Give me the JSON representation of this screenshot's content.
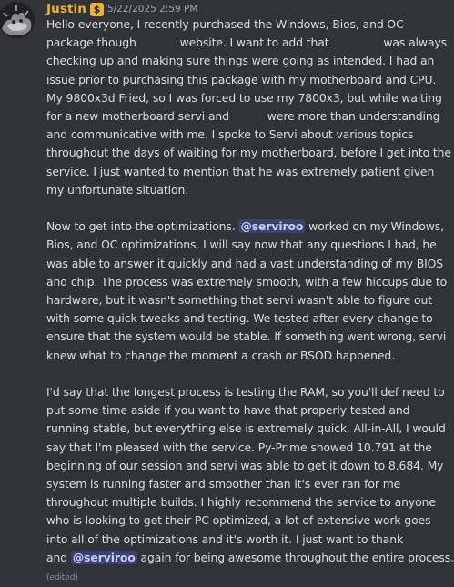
{
  "author": {
    "name": "Justin",
    "badge_icon": "dollar-badge-icon",
    "badge_symbol": "$",
    "badge_color": "#f0b232",
    "avatar_icon": "avatar-icon"
  },
  "timestamp": "5/22/2025 2:59 PM",
  "message": {
    "p1": {
      "s1": "Hello everyone, I recently purchased the Windows, Bios, and OC package though",
      "s2": "website. I want to add that",
      "s3": "was always checking up and making sure things were going as intended. I had an issue prior to purchasing this package with my motherboard and CPU. My 9800x3d Fried, so I was forced to use my 7800x3, but while waiting for a new motherboard servi and",
      "s4": "were more than understanding and communicative with me. I spoke to Servi about various topics throughout the days of waiting for my motherboard, before I get into the service. I just wanted to mention that he was extremely patient given my unfortunate situation."
    },
    "p2": {
      "s1": "Now to get into the optimizations.",
      "mention": "@serviroo",
      "s2": "worked on my Windows, Bios, and OC optimizations. I will say now that any questions I had, he was able to answer it quickly and had a vast understanding of my BIOS and chip. The process was extremely smooth, with a few hiccups due to hardware, but it wasn't something that servi wasn't able to figure out with some quick tweaks and testing. We tested after every change to ensure that the system would be stable. If something went wrong, servi knew what to change the moment a crash or BSOD happened."
    },
    "p3": {
      "s1": "I'd say that the longest process is testing the RAM, so you'll def need to put some time aside if you want to have that properly tested and running stable, but everything else is extremely quick. All-in-All, I would say that I'm pleased with the service. Py-Prime showed 10.791 at the beginning of our session and servi was able to get it down to 8.684. My system is running faster and smoother than it's ever ran for me throughout multiple builds. I highly recommend the service to anyone who is looking to get their PC optimized, a lot of extensive work goes into all of the optimizations and it's worth it. I just want to thank",
      "s2": "and",
      "mention": "@serviroo",
      "s3": "again for being awesome throughout the entire process.",
      "edited": "(edited)"
    }
  },
  "colors": {
    "background": "#323339",
    "text": "#dbdee1",
    "username": "#f0b232",
    "mention_text": "#c9cdfb",
    "timestamp": "#a2a3ac"
  }
}
